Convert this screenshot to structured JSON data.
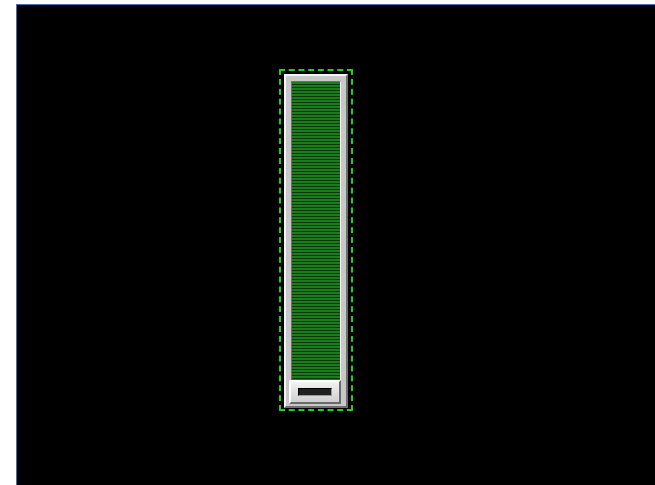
{
  "slider": {
    "orientation": "vertical",
    "value": 1.0,
    "thumb_position": 0.0,
    "focused": true
  },
  "colors": {
    "background": "#000000",
    "focus_ring": "#1fcc1f",
    "fill": "#1d7a1d",
    "frame": "#c8c8c8"
  },
  "icons": {
    "thumb_grip": "grip-icon"
  }
}
